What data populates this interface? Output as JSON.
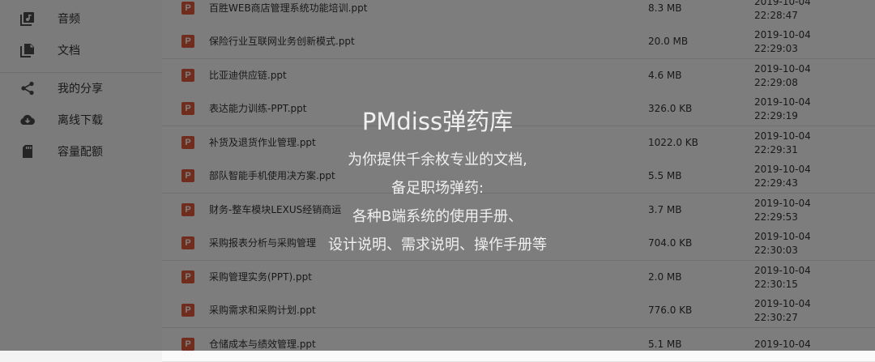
{
  "sidebar": {
    "items": [
      {
        "label": "音频",
        "icon": "audio-icon"
      },
      {
        "label": "文档",
        "icon": "document-icon"
      },
      {
        "label": "我的分享",
        "icon": "share-icon"
      },
      {
        "label": "离线下载",
        "icon": "cloud-download-icon"
      },
      {
        "label": "容量配额",
        "icon": "sd-card-icon"
      }
    ]
  },
  "files": {
    "icon_letter": "P",
    "icon_color": "#e05a3d",
    "rows": [
      {
        "name": "百胜WEB商店管理系统功能培训.ppt",
        "size": "8.3 MB",
        "date": "2019-10-04",
        "time": "22:28:47"
      },
      {
        "name": "保险行业互联网业务创新模式.ppt",
        "size": "20.0 MB",
        "date": "2019-10-04",
        "time": "22:29:03"
      },
      {
        "name": "比亚迪供应链.ppt",
        "size": "4.6 MB",
        "date": "2019-10-04",
        "time": "22:29:08"
      },
      {
        "name": "表达能力训练-PPT.ppt",
        "size": "326.0 KB",
        "date": "2019-10-04",
        "time": "22:29:19"
      },
      {
        "name": "补货及退货作业管理.ppt",
        "size": "1022.0 KB",
        "date": "2019-10-04",
        "time": "22:29:31"
      },
      {
        "name": "部队智能手机使用决方案.ppt",
        "size": "5.5 MB",
        "date": "2019-10-04",
        "time": "22:29:43"
      },
      {
        "name": "财务-整车模块LEXUS经销商运",
        "size": "3.7 MB",
        "date": "2019-10-04",
        "time": "22:29:53"
      },
      {
        "name": "采购报表分析与采购管理",
        "size": "704.0 KB",
        "date": "2019-10-04",
        "time": "22:30:03"
      },
      {
        "name": "采购管理实务(PPT).ppt",
        "size": "2.0 MB",
        "date": "2019-10-04",
        "time": "22:30:15"
      },
      {
        "name": "采购需求和采购计划.ppt",
        "size": "776.0 KB",
        "date": "2019-10-04",
        "time": "22:30:27"
      },
      {
        "name": "仓储成本与绩效管理.ppt",
        "size": "5.1 MB",
        "date": "2019-10-04",
        "time": ""
      }
    ]
  },
  "watermark": {
    "title": "PMdiss弹药库",
    "lines": [
      "为你提供千余枚专业的文档,",
      "备足职场弹药:",
      "各种B端系统的使用手册、",
      "设计说明、需求说明、操作手册等"
    ]
  }
}
